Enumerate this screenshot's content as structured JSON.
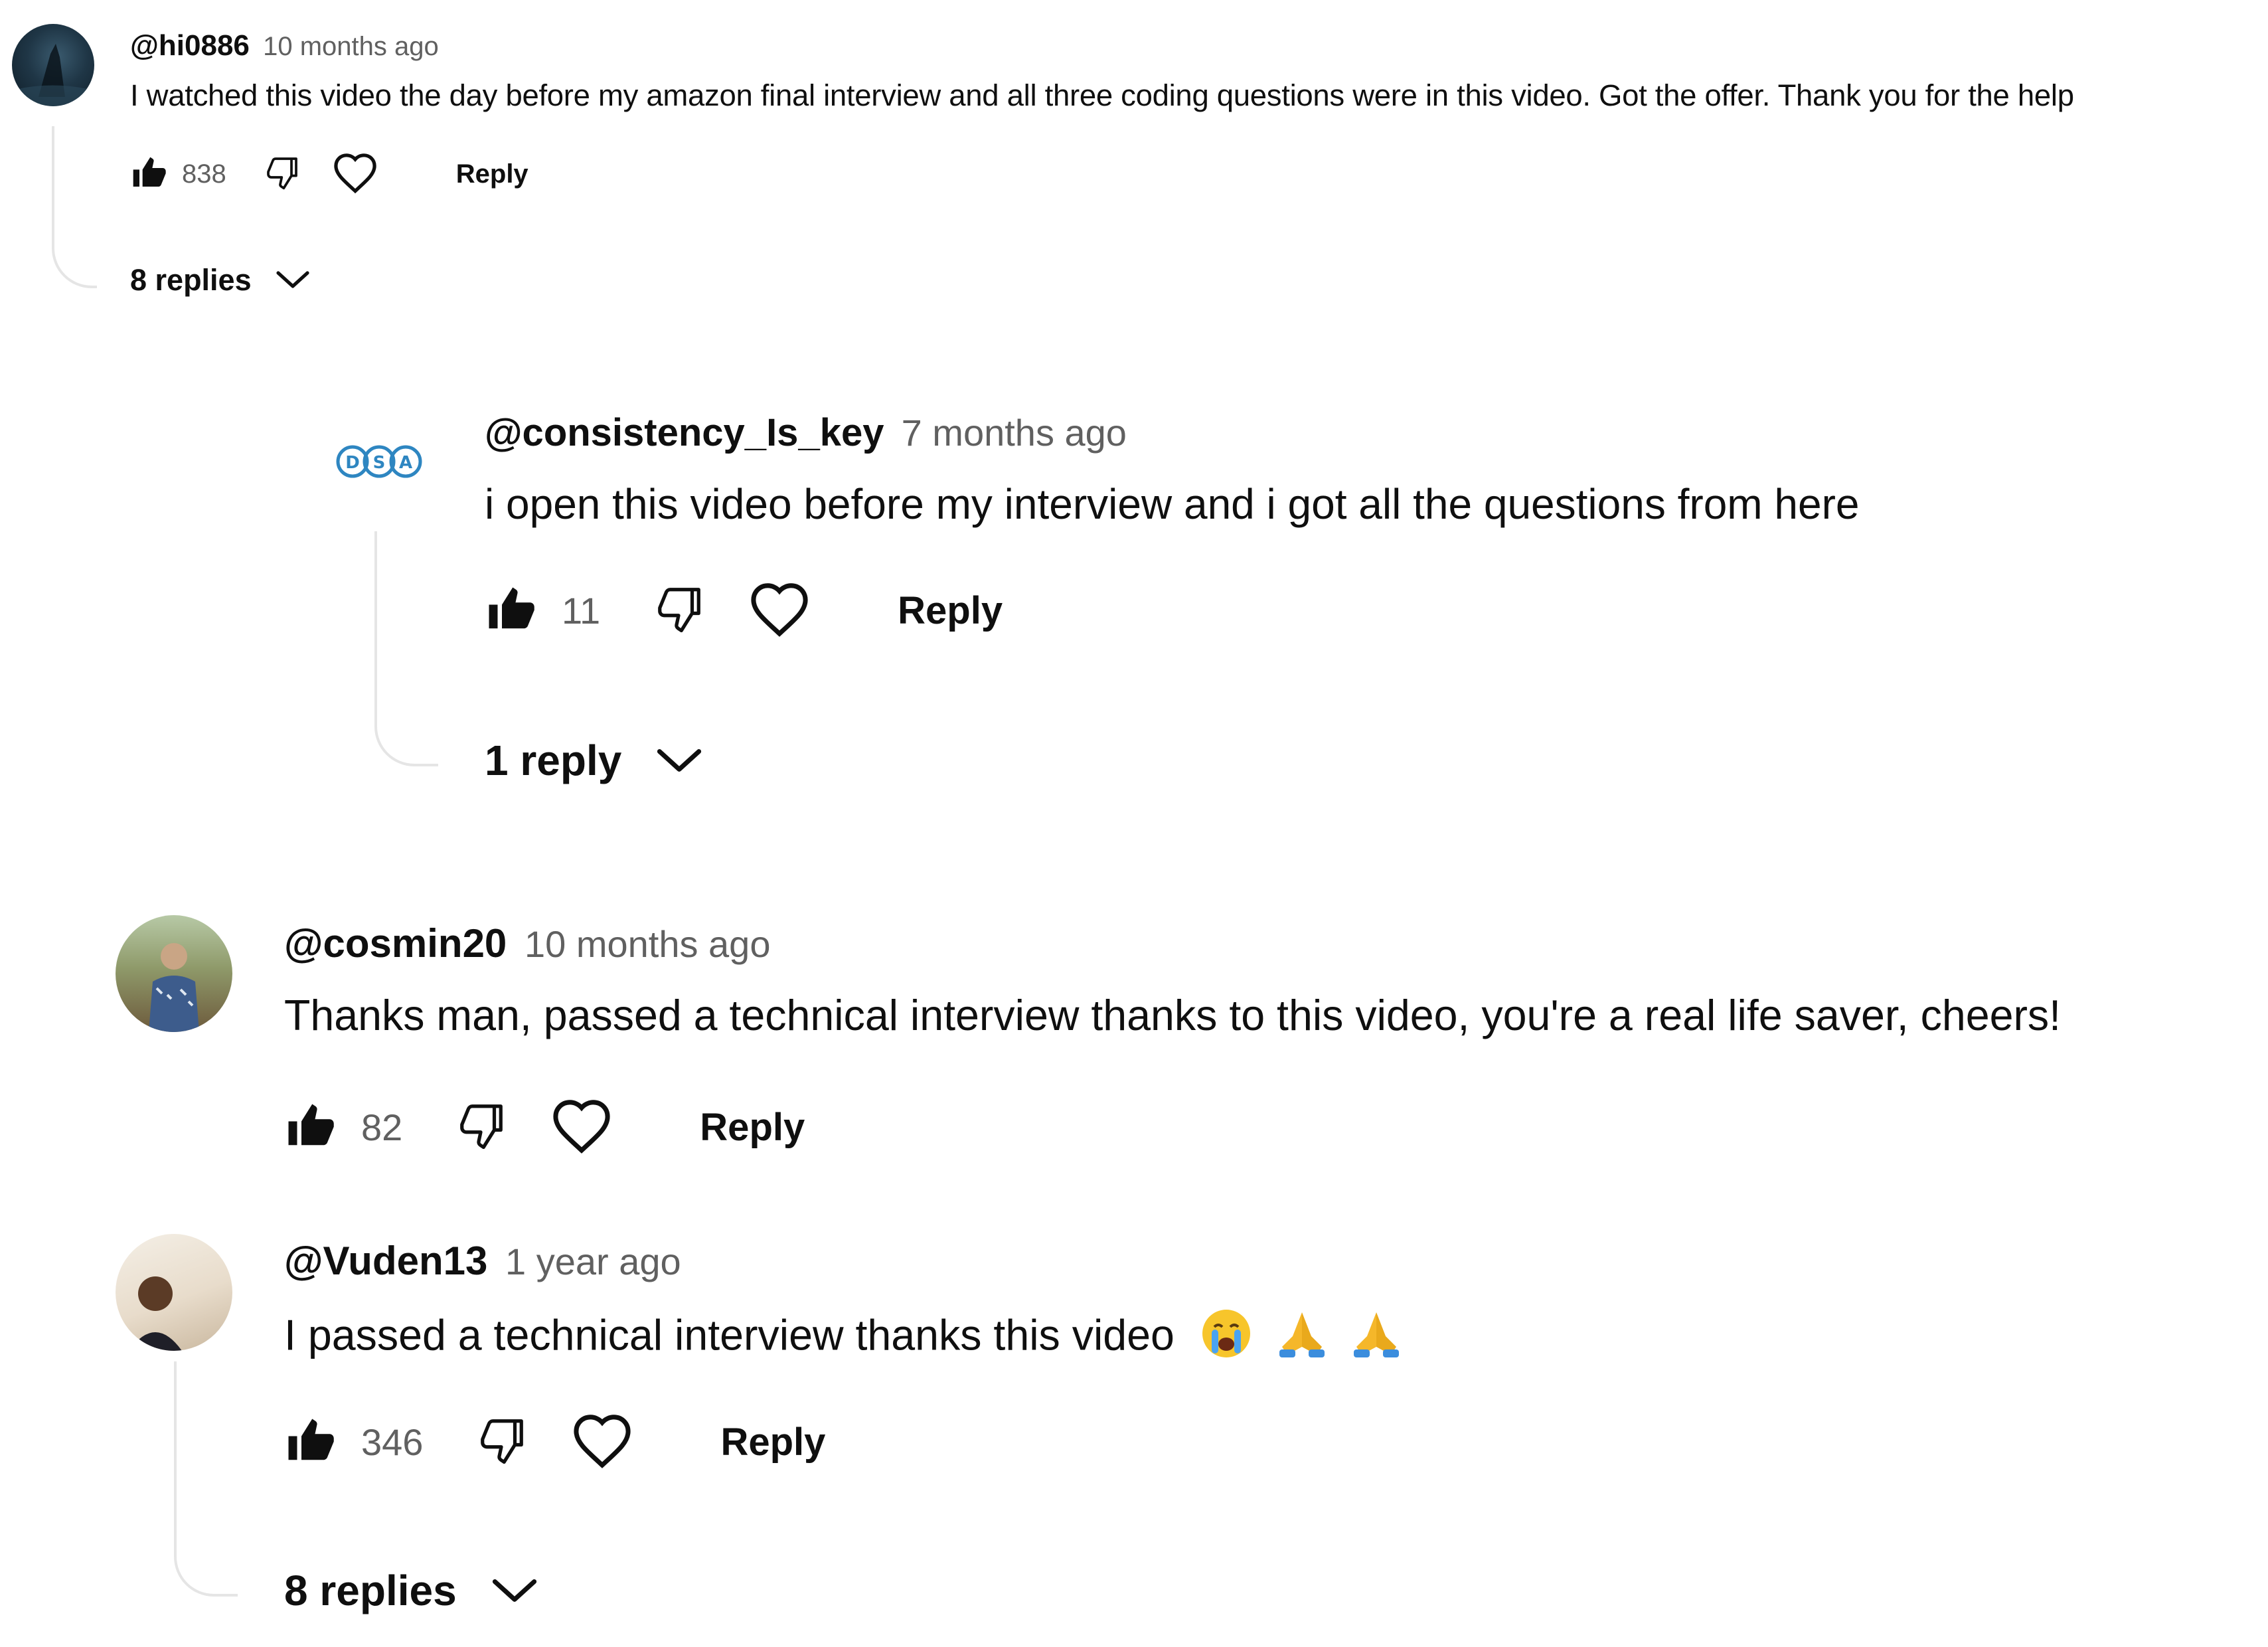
{
  "comments": [
    {
      "handle": "@hi0886",
      "time": "10 months ago",
      "text": "I watched this video the day before my amazon final interview and all three coding questions were in this video. Got the offer. Thank you for the help",
      "likes": "838",
      "reply_label": "Reply",
      "replies_label": "8 replies"
    },
    {
      "handle": "@consistency_Is_key",
      "time": "7 months ago",
      "text": "i open this video before my interview and i got all the questions from here",
      "likes": "11",
      "reply_label": "Reply",
      "replies_label": "1 reply",
      "avatar_text": "DSA"
    },
    {
      "handle": "@cosmin20",
      "time": "10 months ago",
      "text": "Thanks man, passed a technical interview thanks to this video, you're a real life saver, cheers!",
      "likes": "82",
      "reply_label": "Reply"
    },
    {
      "handle": "@Vuden13",
      "time": "1 year ago",
      "text": "I passed a technical interview thanks this video",
      "likes": "346",
      "reply_label": "Reply",
      "replies_label": "8 replies"
    }
  ],
  "colors": {
    "text": "#0f0f0f",
    "secondary": "#606060",
    "thread_line": "#e5e5e5",
    "dsa_blue": "#2e86c1"
  },
  "icons": [
    "thumb-up-icon",
    "thumb-down-icon",
    "heart-icon",
    "chevron-down-icon",
    "crying-face-emoji",
    "folded-hands-emoji"
  ]
}
